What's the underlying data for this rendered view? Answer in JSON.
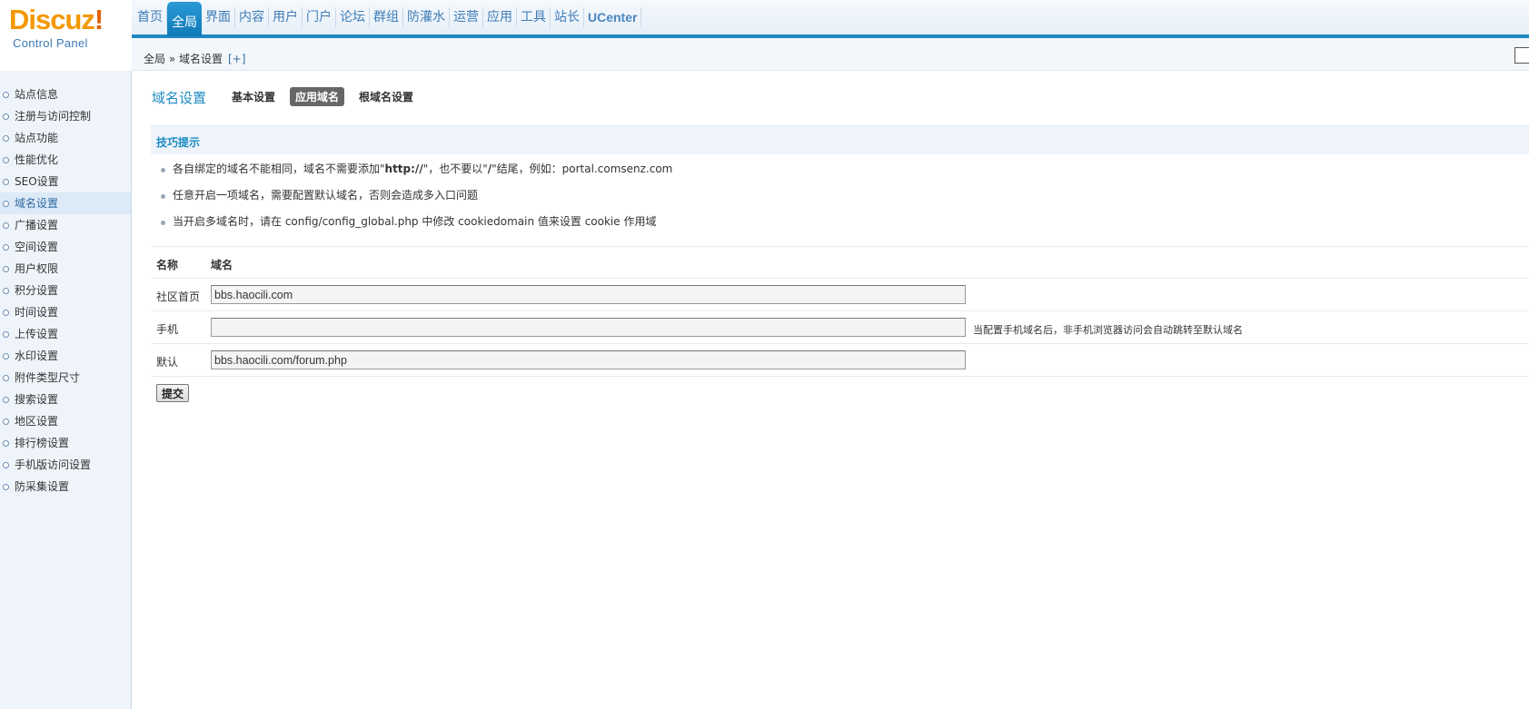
{
  "logo": {
    "brand": "Discuz",
    "exclaim": "!",
    "subtitle": "Control Panel"
  },
  "topnav": {
    "items": [
      "首页",
      "全局",
      "界面",
      "内容",
      "用户",
      "门户",
      "论坛",
      "群组",
      "防灌水",
      "运营",
      "应用",
      "工具",
      "站长",
      "UCenter"
    ],
    "active": "全局"
  },
  "breadcrumb": {
    "path": "全局 » 域名设置",
    "plus": "[+]"
  },
  "sidebar": {
    "items": [
      "站点信息",
      "注册与访问控制",
      "站点功能",
      "性能优化",
      "SEO设置",
      "域名设置",
      "广播设置",
      "空间设置",
      "用户权限",
      "积分设置",
      "时间设置",
      "上传设置",
      "水印设置",
      "附件类型尺寸",
      "搜索设置",
      "地区设置",
      "排行榜设置",
      "手机版访问设置",
      "防采集设置"
    ],
    "active": "域名设置"
  },
  "main": {
    "title": "域名设置",
    "tabs": [
      "基本设置",
      "应用域名",
      "根域名设置"
    ],
    "active_tab": "应用域名"
  },
  "tips": {
    "title": "技巧提示",
    "items": [
      {
        "a": "各自绑定的域名不能相同，域名不需要添加\"",
        "b": "http://",
        "c": "\"，也不要以\"",
        "d": "/",
        "e": "\"结尾，例如：portal.comsenz.com"
      },
      {
        "text": "任意开启一项域名，需要配置默认域名，否则会造成多入口问题"
      },
      {
        "text": "当开启多域名时，请在 config/config_global.php 中修改 cookiedomain 值来设置 cookie 作用域"
      }
    ]
  },
  "form": {
    "header": {
      "name": "名称",
      "domain": "域名"
    },
    "rows": [
      {
        "label": "社区首页",
        "value": "bbs.haocili.com",
        "hint": ""
      },
      {
        "label": "手机",
        "value": "",
        "hint": "当配置手机域名后，非手机浏览器访问会自动跳转至默认域名"
      },
      {
        "label": "默认",
        "value": "bbs.haocili.com/forum.php",
        "hint": ""
      }
    ],
    "submit": "提交"
  },
  "colors": {
    "accent": "#1e89c4",
    "brand": "#f39800",
    "title": "#1c8ac1"
  }
}
